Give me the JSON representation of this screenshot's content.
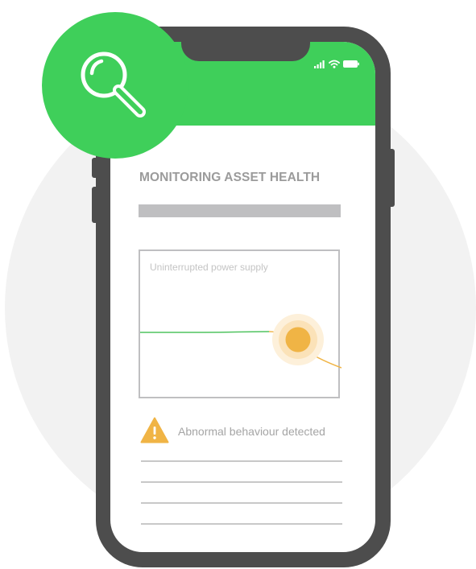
{
  "app": {
    "title": "MONITORING ASSET HEALTH",
    "accent_color": "#3fcf5a",
    "warning_color": "#f0b445"
  },
  "status_bar": {
    "icons": [
      "signal-icon",
      "wifi-icon",
      "battery-icon"
    ]
  },
  "search_badge": {
    "icon": "search-icon"
  },
  "chart_data": {
    "type": "line",
    "title": "Uninterrupted power supply",
    "series": [
      {
        "name": "",
        "trend": "stable then sharp drop after anomaly"
      }
    ],
    "highlight": {
      "type": "anomaly-marker",
      "color": "#f0b445"
    }
  },
  "alert": {
    "icon": "warning-icon",
    "text": "Abnormal behaviour detected"
  },
  "list": {
    "placeholder_rows": 4
  }
}
